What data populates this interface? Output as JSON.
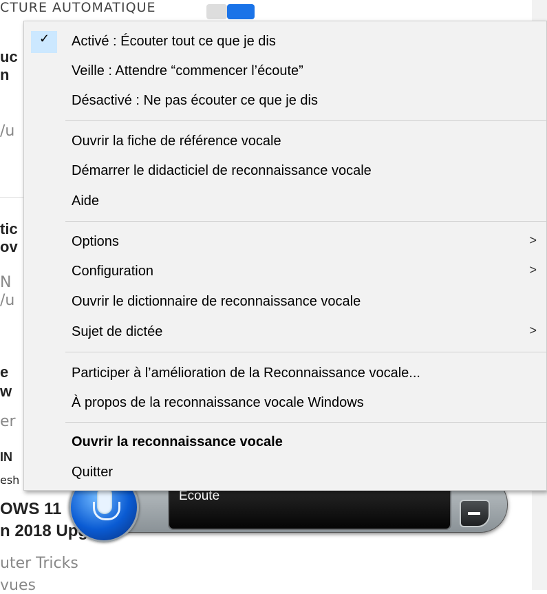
{
  "background": {
    "heading": "CTURE AUTOMATIQUE",
    "fragments": [
      "uc",
      "n",
      "/u",
      "tic",
      "ov",
      "N",
      "/u",
      "e",
      "w",
      "er",
      "IN",
      "esh",
      "OWS 11",
      "n 2018 Upg",
      "uter Tricks",
      "vues"
    ]
  },
  "menu": {
    "items": [
      {
        "label": "Activé : Écouter tout ce que je dis",
        "checked": true
      },
      {
        "label": "Veille : Attendre “commencer l’écoute”"
      },
      {
        "label": "Désactivé : Ne pas écouter ce que je dis"
      },
      {
        "label": "Ouvrir la fiche de référence vocale"
      },
      {
        "label": "Démarrer le didacticiel de reconnaissance vocale"
      },
      {
        "label": "Aide"
      },
      {
        "label": "Options",
        "submenu": true
      },
      {
        "label": "Configuration",
        "submenu": true
      },
      {
        "label": "Ouvrir le dictionnaire de reconnaissance vocale"
      },
      {
        "label": "Sujet de dictée",
        "submenu": true
      },
      {
        "label": "Participer à l’amélioration de la Reconnaissance vocale..."
      },
      {
        "label": "À propos de la reconnaissance vocale Windows"
      },
      {
        "label": "Ouvrir la reconnaissance vocale",
        "bold": true
      },
      {
        "label": "Quitter"
      }
    ],
    "check_glyph": "✓",
    "submenu_glyph": ">"
  },
  "widget": {
    "status": "Écoute",
    "mic_icon": "microphone-icon",
    "minimize_icon": "minimize-icon"
  },
  "colors": {
    "menu_bg": "#f2f2f2",
    "check_highlight": "#cce8ff",
    "mic_blue": "#0a5bd3"
  }
}
